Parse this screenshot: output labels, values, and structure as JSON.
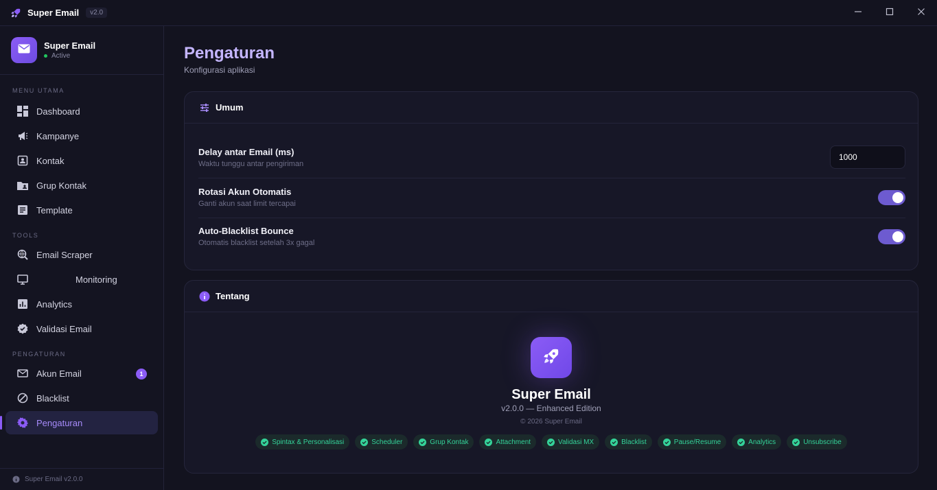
{
  "app": {
    "title": "Super Email",
    "version": "v2.0"
  },
  "window_controls": [
    "minimize-icon",
    "maximize-icon",
    "close-icon"
  ],
  "sidebar": {
    "brand_name": "Super Email",
    "status": "Active",
    "sections": [
      {
        "label": "MENU UTAMA",
        "items": [
          {
            "label": "Dashboard",
            "icon": "dashboard-icon"
          },
          {
            "label": "Kampanye",
            "icon": "megaphone-icon"
          },
          {
            "label": "Kontak",
            "icon": "contact-card-icon"
          },
          {
            "label": "Grup Kontak",
            "icon": "folder-user-icon"
          },
          {
            "label": "Template",
            "icon": "document-icon"
          }
        ]
      },
      {
        "label": "TOOLS",
        "items": [
          {
            "label": "Email Scraper",
            "icon": "search-globe-icon"
          },
          {
            "label": "Monitoring",
            "icon": "monitor-icon"
          },
          {
            "label": "Analytics",
            "icon": "analytics-icon"
          },
          {
            "label": "Validasi Email",
            "icon": "verified-badge-icon"
          }
        ]
      },
      {
        "label": "PENGATURAN",
        "items": [
          {
            "label": "Akun Email",
            "icon": "mail-icon",
            "badge": "1"
          },
          {
            "label": "Blacklist",
            "icon": "block-icon"
          },
          {
            "label": "Pengaturan",
            "icon": "gear-icon",
            "active": true
          }
        ]
      }
    ],
    "footer": "Super Email v2.0.0"
  },
  "page": {
    "title": "Pengaturan",
    "subtitle": "Konfigurasi aplikasi"
  },
  "general": {
    "title": "Umum",
    "delay": {
      "label": "Delay antar Email (ms)",
      "desc": "Waktu tunggu antar pengiriman",
      "value": "1000"
    },
    "rotation": {
      "label": "Rotasi Akun Otomatis",
      "desc": "Ganti akun saat limit tercapai",
      "enabled": true
    },
    "blacklist": {
      "label": "Auto-Blacklist Bounce",
      "desc": "Otomatis blacklist setelah 3x gagal",
      "enabled": true
    }
  },
  "about": {
    "title": "Tentang",
    "name": "Super Email",
    "version": "v2.0.0 — Enhanced Edition",
    "copyright": "© 2026 Super Email",
    "features": [
      "Spintax & Personalisasi",
      "Scheduler",
      "Grup Kontak",
      "Attachment",
      "Validasi MX",
      "Blacklist",
      "Pause/Resume",
      "Analytics",
      "Unsubscribe"
    ]
  },
  "colors": {
    "accent": "#8b5cf6",
    "background": "#13131f",
    "success": "#34d399"
  }
}
